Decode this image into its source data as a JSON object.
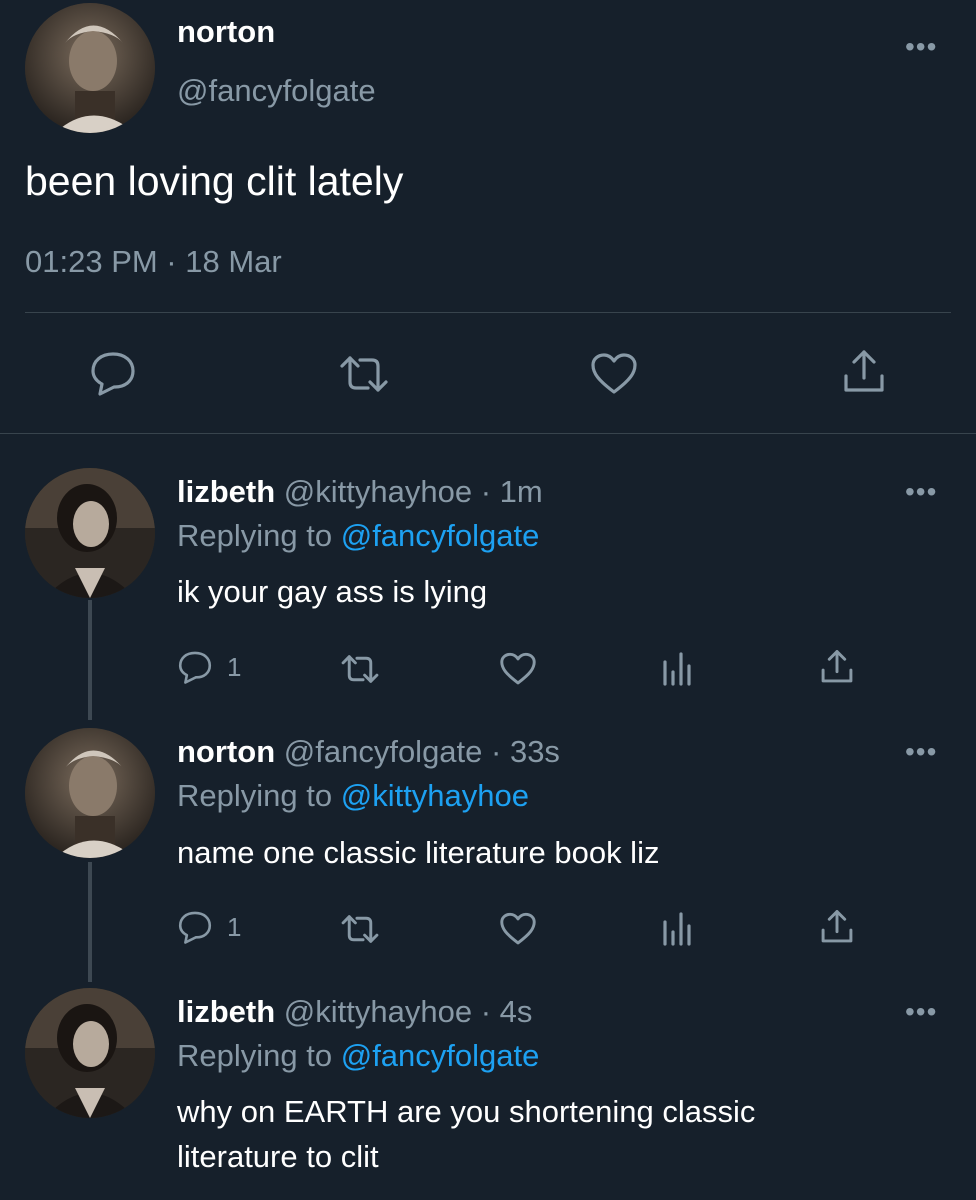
{
  "main_tweet": {
    "display_name": "norton",
    "handle": "@fancyfolgate",
    "text": "been loving clit lately",
    "timestamp": "01:23 PM · 18 Mar",
    "more_label": "•••",
    "actions": [
      "reply-icon",
      "retweet-icon",
      "like-icon",
      "share-icon"
    ]
  },
  "replies": [
    {
      "display_name": "lizbeth",
      "meta": "@kittyhayhoe · 1m",
      "replying_prefix": "Replying to",
      "replying_to": "@fancyfolgate",
      "text": "ik your gay ass is lying",
      "reply_count": "1",
      "more_label": "•••"
    },
    {
      "display_name": "norton",
      "meta": "@fancyfolgate · 33s",
      "replying_prefix": "Replying to",
      "replying_to": "@kittyhayhoe",
      "text": "name one classic literature book liz",
      "reply_count": "1",
      "more_label": "•••"
    },
    {
      "display_name": "lizbeth",
      "meta": "@kittyhayhoe · 4s",
      "replying_prefix": "Replying to",
      "replying_to": "@fancyfolgate",
      "text_line1": "why on EARTH are you shortening classic",
      "text_line2": "literature to clit",
      "more_label": "•••"
    }
  ],
  "colors": {
    "background": "#16202b",
    "text": "#ffffff",
    "muted": "#8899a6",
    "link": "#1da1f2",
    "divider": "#38444d"
  }
}
